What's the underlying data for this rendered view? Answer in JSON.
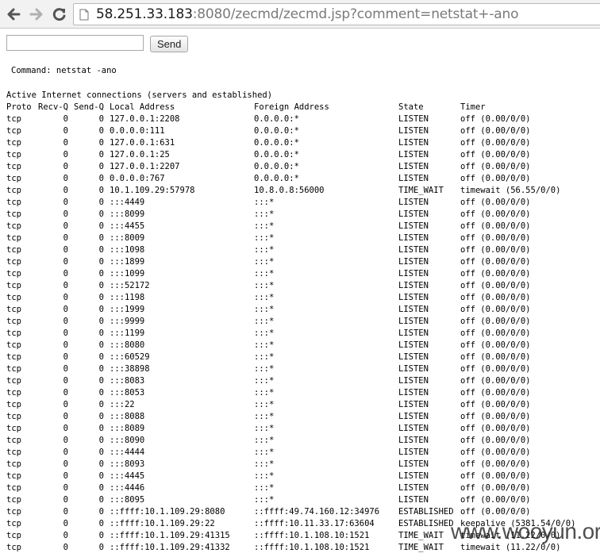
{
  "browser": {
    "url_host": "58.251.33.183",
    "url_rest": ":8080/zecmd/zecmd.jsp?comment=netstat+-ano"
  },
  "form": {
    "input_value": "",
    "send_label": "Send"
  },
  "command_line": "Command: netstat -ano",
  "output": {
    "heading": "Active Internet connections (servers and established)",
    "headers": {
      "proto": "Proto",
      "recv": "Recv-Q",
      "send": "Send-Q",
      "local": "Local Address",
      "foreign": "Foreign Address",
      "state": "State",
      "timer": "Timer"
    },
    "rows": [
      [
        "tcp",
        "0",
        "0",
        "127.0.0.1:2208",
        "0.0.0.0:*",
        "LISTEN",
        "off (0.00/0/0)"
      ],
      [
        "tcp",
        "0",
        "0",
        "0.0.0.0:111",
        "0.0.0.0:*",
        "LISTEN",
        "off (0.00/0/0)"
      ],
      [
        "tcp",
        "0",
        "0",
        "127.0.0.1:631",
        "0.0.0.0:*",
        "LISTEN",
        "off (0.00/0/0)"
      ],
      [
        "tcp",
        "0",
        "0",
        "127.0.0.1:25",
        "0.0.0.0:*",
        "LISTEN",
        "off (0.00/0/0)"
      ],
      [
        "tcp",
        "0",
        "0",
        "127.0.0.1:2207",
        "0.0.0.0:*",
        "LISTEN",
        "off (0.00/0/0)"
      ],
      [
        "tcp",
        "0",
        "0",
        "0.0.0.0:767",
        "0.0.0.0:*",
        "LISTEN",
        "off (0.00/0/0)"
      ],
      [
        "tcp",
        "0",
        "0",
        "10.1.109.29:57978",
        "10.8.0.8:56000",
        "TIME_WAIT",
        "timewait (56.55/0/0)"
      ],
      [
        "tcp",
        "0",
        "0",
        ":::4449",
        ":::*",
        "LISTEN",
        "off (0.00/0/0)"
      ],
      [
        "tcp",
        "0",
        "0",
        ":::8099",
        ":::*",
        "LISTEN",
        "off (0.00/0/0)"
      ],
      [
        "tcp",
        "0",
        "0",
        ":::4455",
        ":::*",
        "LISTEN",
        "off (0.00/0/0)"
      ],
      [
        "tcp",
        "0",
        "0",
        ":::8009",
        ":::*",
        "LISTEN",
        "off (0.00/0/0)"
      ],
      [
        "tcp",
        "0",
        "0",
        ":::1098",
        ":::*",
        "LISTEN",
        "off (0.00/0/0)"
      ],
      [
        "tcp",
        "0",
        "0",
        ":::1899",
        ":::*",
        "LISTEN",
        "off (0.00/0/0)"
      ],
      [
        "tcp",
        "0",
        "0",
        ":::1099",
        ":::*",
        "LISTEN",
        "off (0.00/0/0)"
      ],
      [
        "tcp",
        "0",
        "0",
        ":::52172",
        ":::*",
        "LISTEN",
        "off (0.00/0/0)"
      ],
      [
        "tcp",
        "0",
        "0",
        ":::1198",
        ":::*",
        "LISTEN",
        "off (0.00/0/0)"
      ],
      [
        "tcp",
        "0",
        "0",
        ":::1999",
        ":::*",
        "LISTEN",
        "off (0.00/0/0)"
      ],
      [
        "tcp",
        "0",
        "0",
        ":::9999",
        ":::*",
        "LISTEN",
        "off (0.00/0/0)"
      ],
      [
        "tcp",
        "0",
        "0",
        ":::1199",
        ":::*",
        "LISTEN",
        "off (0.00/0/0)"
      ],
      [
        "tcp",
        "0",
        "0",
        ":::8080",
        ":::*",
        "LISTEN",
        "off (0.00/0/0)"
      ],
      [
        "tcp",
        "0",
        "0",
        ":::60529",
        ":::*",
        "LISTEN",
        "off (0.00/0/0)"
      ],
      [
        "tcp",
        "0",
        "0",
        ":::38898",
        ":::*",
        "LISTEN",
        "off (0.00/0/0)"
      ],
      [
        "tcp",
        "0",
        "0",
        ":::8083",
        ":::*",
        "LISTEN",
        "off (0.00/0/0)"
      ],
      [
        "tcp",
        "0",
        "0",
        ":::8053",
        ":::*",
        "LISTEN",
        "off (0.00/0/0)"
      ],
      [
        "tcp",
        "0",
        "0",
        ":::22",
        ":::*",
        "LISTEN",
        "off (0.00/0/0)"
      ],
      [
        "tcp",
        "0",
        "0",
        ":::8088",
        ":::*",
        "LISTEN",
        "off (0.00/0/0)"
      ],
      [
        "tcp",
        "0",
        "0",
        ":::8089",
        ":::*",
        "LISTEN",
        "off (0.00/0/0)"
      ],
      [
        "tcp",
        "0",
        "0",
        ":::8090",
        ":::*",
        "LISTEN",
        "off (0.00/0/0)"
      ],
      [
        "tcp",
        "0",
        "0",
        ":::4444",
        ":::*",
        "LISTEN",
        "off (0.00/0/0)"
      ],
      [
        "tcp",
        "0",
        "0",
        ":::8093",
        ":::*",
        "LISTEN",
        "off (0.00/0/0)"
      ],
      [
        "tcp",
        "0",
        "0",
        ":::4445",
        ":::*",
        "LISTEN",
        "off (0.00/0/0)"
      ],
      [
        "tcp",
        "0",
        "0",
        ":::4446",
        ":::*",
        "LISTEN",
        "off (0.00/0/0)"
      ],
      [
        "tcp",
        "0",
        "0",
        ":::8095",
        ":::*",
        "LISTEN",
        "off (0.00/0/0)"
      ],
      [
        "tcp",
        "0",
        "0",
        "::ffff:10.1.109.29:8080",
        "::ffff:49.74.160.12:34976",
        "ESTABLISHED",
        "off (0.00/0/0)"
      ],
      [
        "tcp",
        "0",
        "0",
        "::ffff:10.1.109.29:22",
        "::ffff:10.11.33.17:63604",
        "ESTABLISHED",
        "keepalive (5381.54/0/0)"
      ],
      [
        "tcp",
        "0",
        "0",
        "::ffff:10.1.109.29:41315",
        "::ffff:10.1.108.10:1521",
        "TIME_WAIT",
        "timewait (11.22/0/0)"
      ],
      [
        "tcp",
        "0",
        "0",
        "::ffff:10.1.109.29:41332",
        "::ffff:10.1.108.10:1521",
        "TIME_WAIT",
        "timewait (11.22/0/0)"
      ]
    ]
  },
  "watermark": "www.wooyun.org",
  "icons": {
    "back": "back-arrow-icon",
    "forward": "forward-arrow-icon",
    "reload": "reload-icon",
    "page": "page-icon"
  },
  "colors": {
    "toolbar": "#f2f2f2",
    "icon": "#555555",
    "url_host": "#1a1a1a",
    "url_rest": "#7a7a7a"
  }
}
